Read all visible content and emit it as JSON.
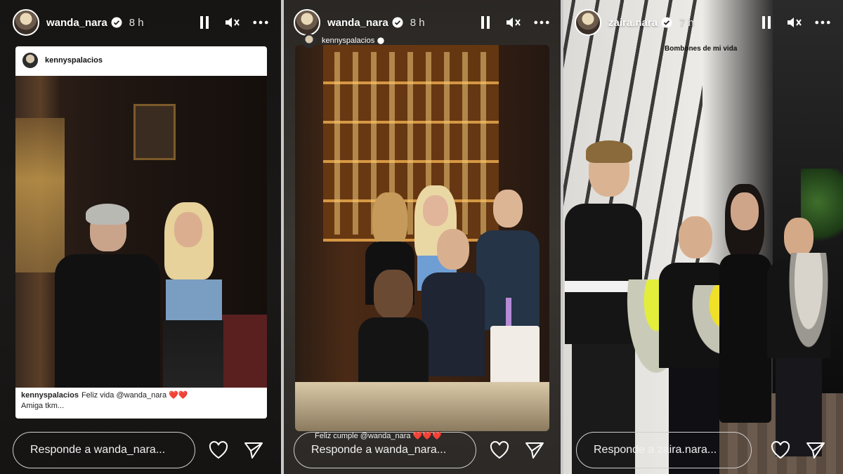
{
  "stories": [
    {
      "username": "wanda_nara",
      "time": "8 h",
      "reshare": {
        "username": "kennyspalacios",
        "caption_user": "kennyspalacios",
        "caption_text": "Feliz vida @wanda_nara ❤️❤️",
        "caption_line2": "Amiga tkm..."
      },
      "reply_placeholder": "Responde a wanda_nara..."
    },
    {
      "username": "wanda_nara",
      "time": "8 h",
      "tag": "kennyspalacios",
      "overlay_text": "Feliz cumple @wanda_nara ❤️❤️❤️",
      "reply_placeholder": "Responde a wanda_nara..."
    },
    {
      "username": "zaira.nara",
      "time": "7 h",
      "overlay_text": "Bombones de mi vida",
      "reply_placeholder": "Responde a zaira.nara..."
    }
  ],
  "icons": [
    "verified-icon",
    "pause-icon",
    "mute-icon",
    "more-icon",
    "heart-icon",
    "send-icon"
  ]
}
